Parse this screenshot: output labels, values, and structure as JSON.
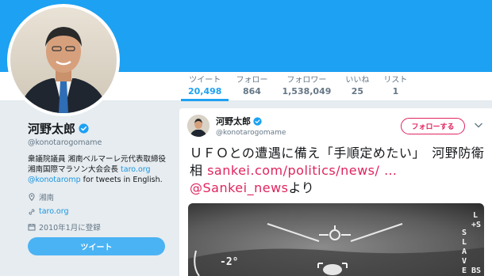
{
  "profile": {
    "name": "河野太郎",
    "handle": "@konotarogomame",
    "bio_main": "衆議院議員 湘南ベルマーレ元代表取締役 湘南国際マラソン大会会長 ",
    "bio_site": "taro.org",
    "bio_mention": "@konotaromp",
    "bio_tail": " for tweets in English.",
    "location": "湘南",
    "website": "taro.org",
    "joined": "2010年1月に登録",
    "tweet_button": "ツイート"
  },
  "stats": [
    {
      "label": "ツイート",
      "value": "20,498"
    },
    {
      "label": "フォロー",
      "value": "864"
    },
    {
      "label": "フォロワー",
      "value": "1,538,049"
    },
    {
      "label": "いいね",
      "value": "25"
    },
    {
      "label": "リスト",
      "value": "1"
    }
  ],
  "tweet": {
    "name": "河野太郎",
    "handle": "@konotarogomame",
    "follow_label": "フォローする",
    "text_main": "ＵＦＯとの遭遇に備え「手順定めたい」　河野防衛相 ",
    "link_url": "sankei.com/politics/news/ …",
    "mention": "@Sankei_news",
    "suffix": "より",
    "media_texts": [
      "-2°",
      "L",
      "+S",
      "S",
      "L",
      "A",
      "V",
      "E",
      "BS"
    ]
  },
  "colors": {
    "banner": "#1da1f2",
    "accent": "#1da1f2",
    "link": "#1b95e0",
    "follow": "#e0245e",
    "tweet_button": "#4ab3f4"
  },
  "icons": {
    "verified": "verified-badge-icon",
    "location": "map-pin-icon",
    "link": "link-icon",
    "calendar": "calendar-icon",
    "caret": "chevron-down-icon"
  }
}
